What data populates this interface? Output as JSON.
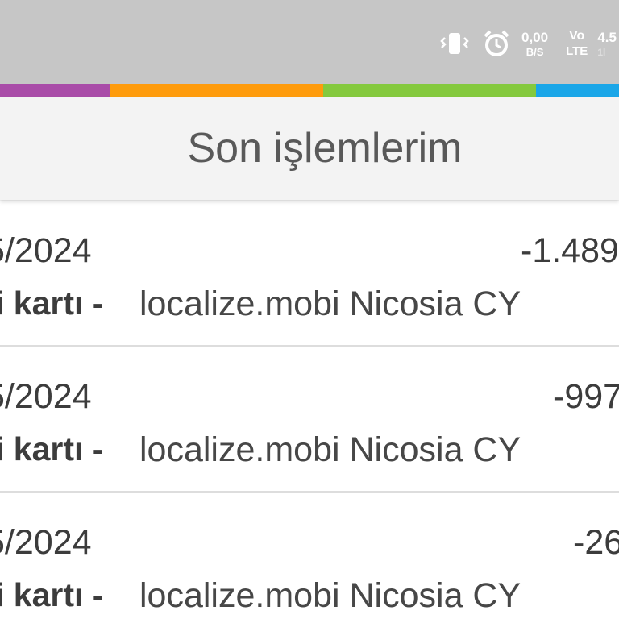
{
  "status_bar": {
    "icons": [
      "vibrate-icon",
      "alarm-icon"
    ],
    "net_speed_value": "0,00",
    "net_speed_unit": "B/S",
    "volte_top": "Vo",
    "volte_bottom": "LTE",
    "network_top": "4.5",
    "network_bottom": "1l"
  },
  "stripe_colors": [
    "#a94ca8",
    "#fe9b0c",
    "#84c93d",
    "#1aa6e8"
  ],
  "header": {
    "title": "Son işlemlerim"
  },
  "transactions": [
    {
      "date": "5/2024",
      "amount": "-1.489",
      "card_label": "i kartı -",
      "merchant": "localize.mobi Nicosia CY"
    },
    {
      "date": "5/2024",
      "amount": "-997",
      "card_label": "i kartı -",
      "merchant": "localize.mobi Nicosia CY"
    },
    {
      "date": "5/2024",
      "amount": "-26",
      "card_label": "i kartı -",
      "merchant": "localize.mobi Nicosia CY"
    }
  ]
}
